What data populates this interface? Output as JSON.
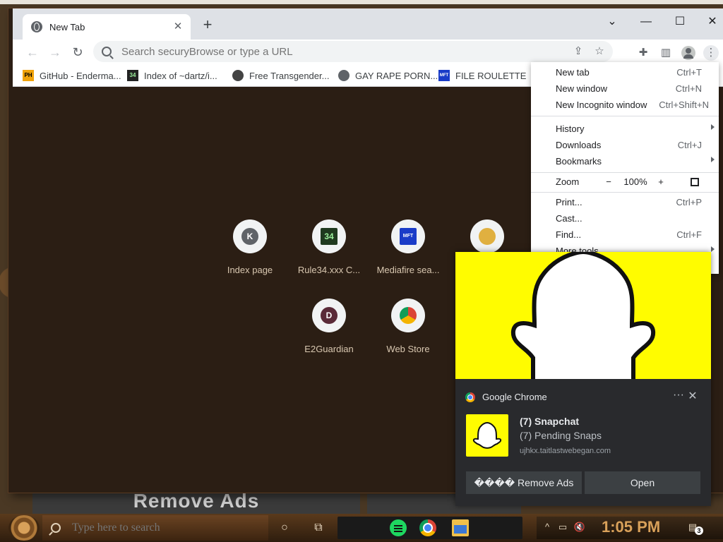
{
  "browser": {
    "tab_title": "New Tab",
    "omnibox_placeholder": "Search securyBrowse or type a URL",
    "bookmarks": [
      {
        "label": "GitHub - Enderma...",
        "icon": "ph-icon",
        "fav_text": "PH"
      },
      {
        "label": "Index of ~dartz/i...",
        "icon": "rule34-icon",
        "fav_text": "34"
      },
      {
        "label": "Free Transgender...",
        "icon": "face-icon",
        "fav_text": ""
      },
      {
        "label": "GAY RAPE PORN...",
        "icon": "globe-icon",
        "fav_text": ""
      },
      {
        "label": "FILE ROULETTE",
        "icon": "mft-icon",
        "fav_text": "MFT"
      }
    ],
    "shortcuts": [
      {
        "label": "Index page",
        "letter": "K"
      },
      {
        "label": "Rule34.xxx C...",
        "letter": "34"
      },
      {
        "label": "Mediafire sea...",
        "letter": "MFT"
      },
      {
        "label": "",
        "letter": ""
      },
      {
        "label": "E2Guardian",
        "letter": "D"
      },
      {
        "label": "Web Store",
        "letter": ""
      }
    ]
  },
  "menu": {
    "items": [
      {
        "label": "New tab",
        "shortcut": "Ctrl+T"
      },
      {
        "label": "New window",
        "shortcut": "Ctrl+N"
      },
      {
        "label": "New Incognito window",
        "shortcut": "Ctrl+Shift+N"
      },
      {
        "label": "History",
        "shortcut": ""
      },
      {
        "label": "Downloads",
        "shortcut": "Ctrl+J"
      },
      {
        "label": "Bookmarks",
        "shortcut": ""
      },
      {
        "label": "Print...",
        "shortcut": "Ctrl+P"
      },
      {
        "label": "Cast...",
        "shortcut": ""
      },
      {
        "label": "Find...",
        "shortcut": "Ctrl+F"
      },
      {
        "label": "More tools",
        "shortcut": ""
      }
    ],
    "zoom_label": "Zoom",
    "zoom_minus": "−",
    "zoom_value": "100%",
    "zoom_plus": "+"
  },
  "notification": {
    "app": "Google Chrome",
    "title": "(7) Snapchat",
    "message": "(7) Pending Snaps",
    "source": "ujhkx.taitlastwebegan.com",
    "btn_remove": "���� Remove Ads",
    "btn_open": "Open",
    "more": "···",
    "close": "✕"
  },
  "background": {
    "remove_ads": "Remove Ads"
  },
  "taskbar": {
    "search_placeholder": "Type here to search",
    "time": "1:05 PM",
    "notif_count": "3"
  }
}
